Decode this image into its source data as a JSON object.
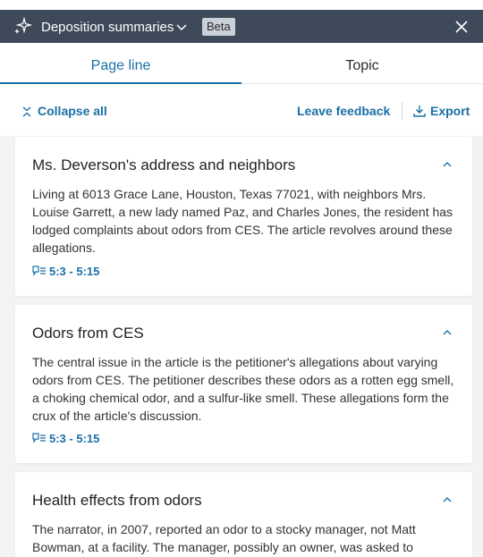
{
  "header": {
    "title": "Deposition summaries",
    "badge": "Beta",
    "icons": {
      "sparkle": "sparkle-icon",
      "dropdown": "chevron-down-icon",
      "close": "close-icon"
    }
  },
  "tabs": [
    {
      "label": "Page line",
      "active": true
    },
    {
      "label": "Topic",
      "active": false
    }
  ],
  "toolbar": {
    "collapse_label": "Collapse all",
    "feedback_label": "Leave feedback",
    "export_label": "Export"
  },
  "summaries": [
    {
      "title": "Ms. Deverson's address and neighbors",
      "body": "Living at 6013 Grace Lane, Houston, Texas 77021, with neighbors Mrs. Louise Garrett, a new lady named Paz, and Charles Jones, the resident has lodged complaints about odors from CES. The article revolves around these allegations.",
      "ref": "5:3 - 5:15"
    },
    {
      "title": "Odors from CES",
      "body": "The central issue in the article is the petitioner's allegations about varying odors from CES. The petitioner describes these odors as a rotten egg smell, a choking chemical odor, and a sulfur-like smell. These allegations form the crux of the article's discussion.",
      "ref": "5:3 - 5:15"
    },
    {
      "title": "Health effects from odors",
      "body": "The narrator, in 2007, reported an odor to a stocky manager, not Matt Bowman, at a facility. The manager, possibly an owner, was asked to",
      "ref": ""
    }
  ],
  "colors": {
    "header_bg": "#3e4a5a",
    "accent": "#1a70a6",
    "page_bg": "#f2f3f5"
  }
}
